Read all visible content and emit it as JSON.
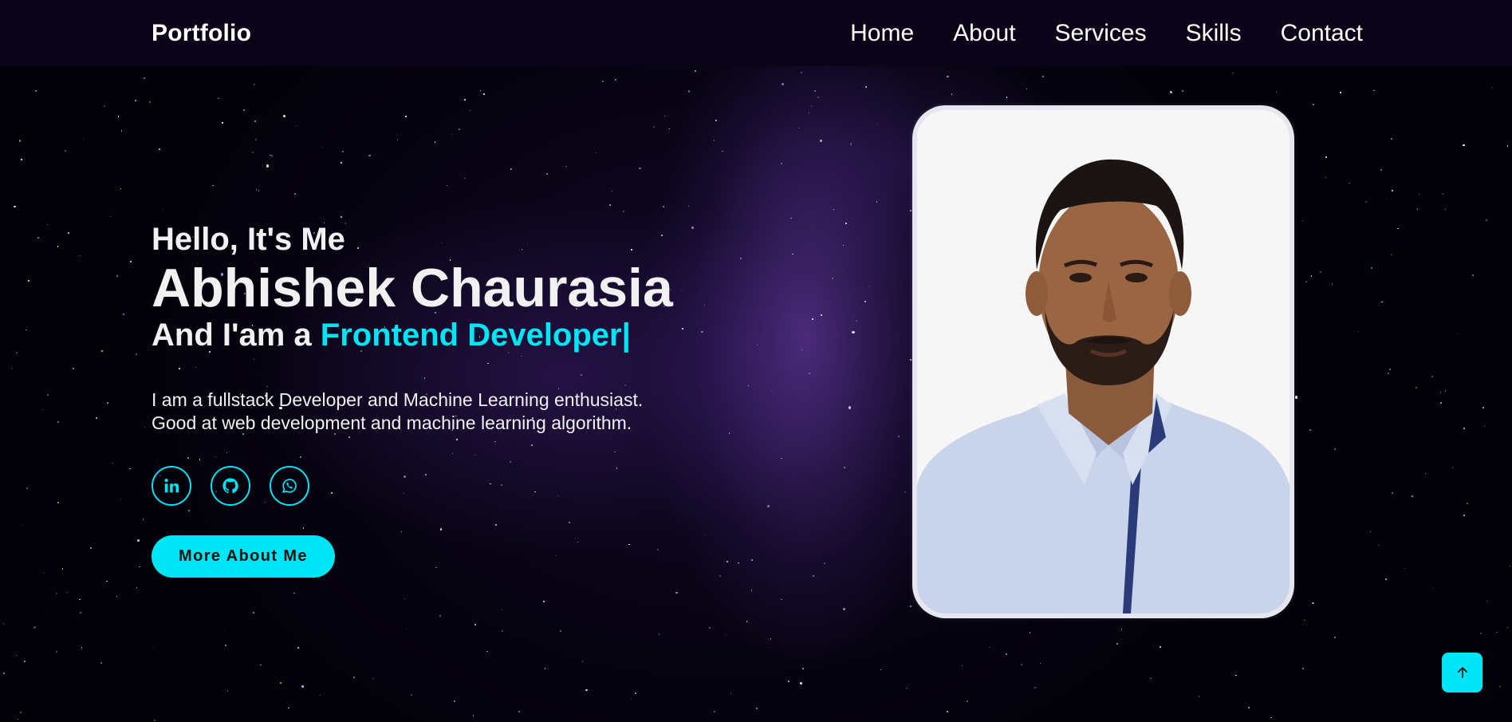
{
  "header": {
    "logo": "Portfolio",
    "nav": [
      "Home",
      "About",
      "Services",
      "Skills",
      "Contact"
    ]
  },
  "hero": {
    "greeting": "Hello, It's Me",
    "name": "Abhishek Chaurasia",
    "role_prefix": "And I'am a ",
    "role_typed": "Frontend Developer|",
    "description_line1": "I am a fullstack Developer and Machine Learning enthusiast.",
    "description_line2": "Good at web development and machine learning algorithm.",
    "socials": [
      "linkedin-icon",
      "github-icon",
      "whatsapp-icon"
    ],
    "button_label": "More About Me"
  },
  "profile_image": {
    "description": "portrait-photo"
  },
  "scroll_top": {
    "icon": "arrow-up-icon"
  },
  "colors": {
    "accent": "#00e5f6",
    "header_bg": "#0b0418",
    "page_bg": "#020108",
    "text": "#f1f1f1"
  }
}
